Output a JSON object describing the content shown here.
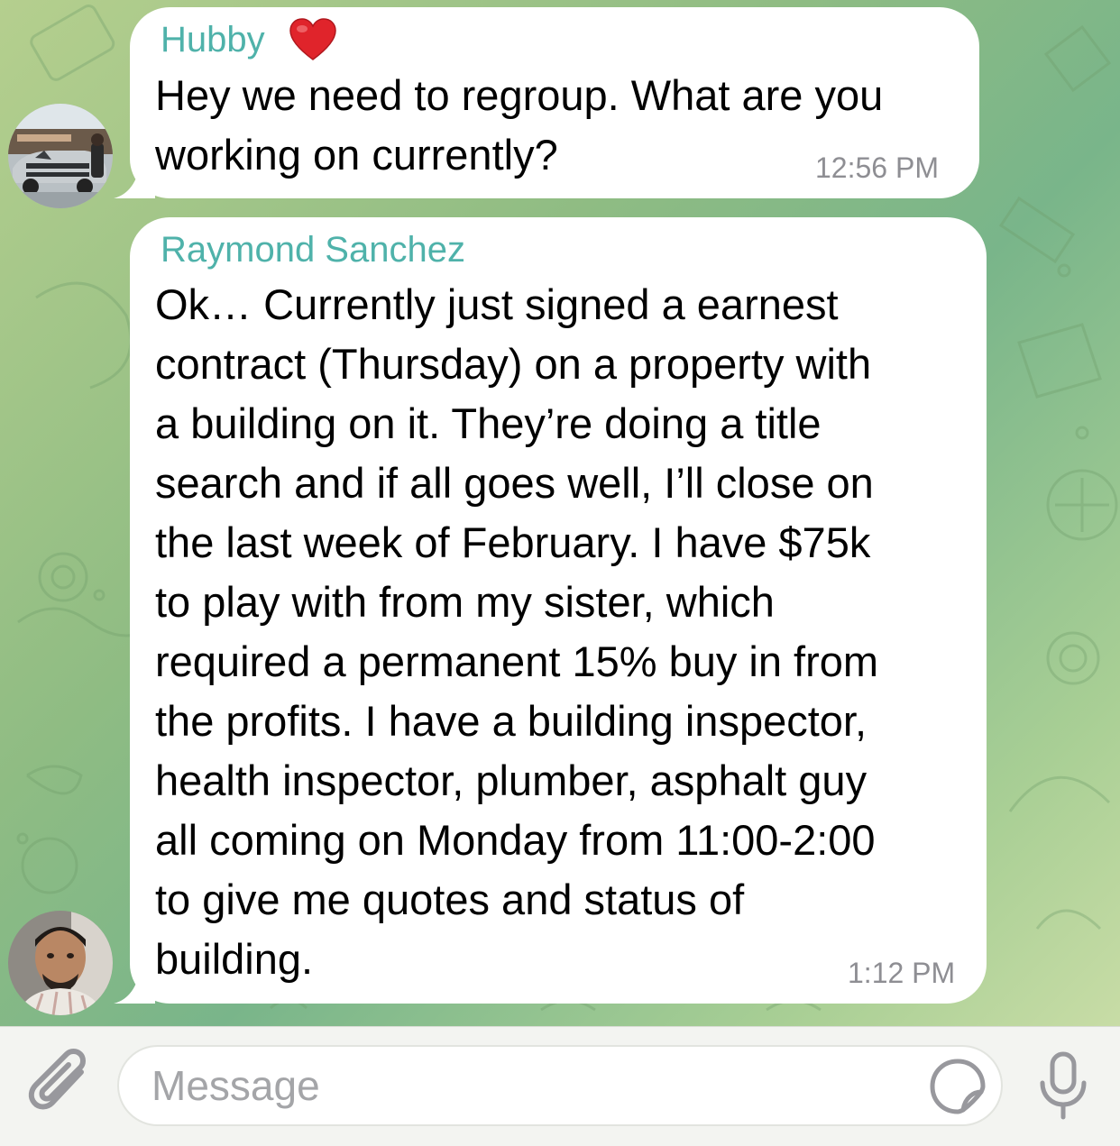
{
  "messages": [
    {
      "sender": "Hubby",
      "sender_emoji": "heart-icon",
      "lines": [
        "Hey we need to regroup. What are you",
        "working on currently?"
      ],
      "time": "12:56 PM"
    },
    {
      "sender": "Raymond Sanchez",
      "lines": [
        "Ok… Currently just signed a earnest",
        "contract (Thursday) on a property with",
        "a building on it. They’re doing a title",
        "search and if all goes well, I’ll close on",
        "the last week of February. I have $75k",
        "to play with from my sister, which",
        "required a permanent 15% buy in from",
        "the profits. I have a building inspector,",
        "health inspector, plumber, asphalt guy",
        "all coming on Monday from 11:00-2:00",
        "to give me quotes and status of",
        "building."
      ],
      "time": "1:12 PM"
    }
  ],
  "composer": {
    "placeholder": "Message",
    "icons": [
      "paperclip-icon",
      "sticker-icon",
      "microphone-icon"
    ]
  },
  "colors": {
    "sender_name": "#4fb2aa",
    "heart": "#e0242b",
    "timestamp": "#8e8e93",
    "bubble": "#ffffff",
    "input_bar": "#f3f4f1"
  }
}
